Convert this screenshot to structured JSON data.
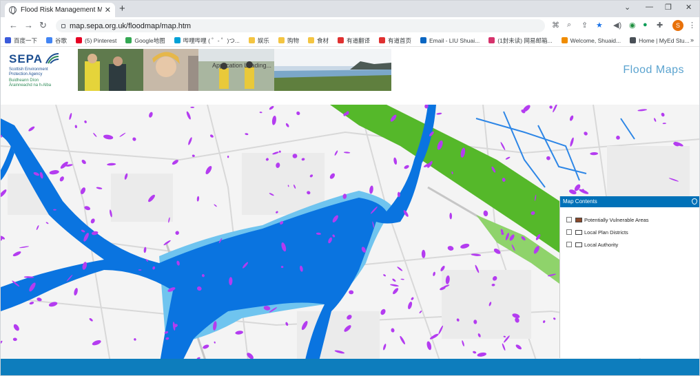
{
  "browser": {
    "tab_title": "Flood Risk Management Maps",
    "tab_close": "✕",
    "new_tab": "+",
    "url": "map.sepa.org.uk/floodmap/map.htm",
    "profile_initial": "S",
    "window_controls": [
      "⌄",
      "—",
      "❐",
      "✕"
    ]
  },
  "bookmarks": [
    {
      "label": "百度一下",
      "color": "#3b5bdb"
    },
    {
      "label": "谷歌",
      "color": "#4285f4"
    },
    {
      "label": "(5) Pinterest",
      "color": "#e60023"
    },
    {
      "label": "Google地图",
      "color": "#34a853"
    },
    {
      "label": "哔哩哔哩 ( ゜- ゜)つ...",
      "color": "#00a1d6"
    },
    {
      "label": "娱乐",
      "color": "#f4c542"
    },
    {
      "label": "购物",
      "color": "#f4c542"
    },
    {
      "label": "食材",
      "color": "#f4c542"
    },
    {
      "label": "有道翻译",
      "color": "#e03131"
    },
    {
      "label": "有道首页",
      "color": "#e03131"
    },
    {
      "label": "Email - LIU Shuai...",
      "color": "#0a66c2"
    },
    {
      "label": "(1封未读) 网易邮箱...",
      "color": "#d6336c"
    },
    {
      "label": "Welcome, Shuaid...",
      "color": "#f08c00"
    },
    {
      "label": "Home | MyEd Stu...",
      "color": "#495057"
    }
  ],
  "bookmarks_more": "»",
  "header": {
    "logo_brand": "SEPA",
    "logo_line1": "Scottish Environment",
    "logo_line2": "Protection Agency",
    "logo_gaelic1": "Buidheann Dìon",
    "logo_gaelic2": "Àrainneachd na h-Alba",
    "banner_label": "Application Loading...",
    "page_title": "Flood  Maps"
  },
  "panel": {
    "title": "Map Contents",
    "layers": [
      {
        "label": "Potentially Vulnerable Areas",
        "swatch": "#8b4a2b"
      },
      {
        "label": "Local Plan Districts",
        "swatch": "#ffffff"
      },
      {
        "label": "Local Authority",
        "swatch": "#ffffff"
      }
    ]
  },
  "colors": {
    "river_flood": "#0a74e0",
    "river_flood_light": "#6fc4ef",
    "surface_water": "#b43cf0",
    "coastal_green": "#55b82a",
    "brand_blue": "#0d7dbd"
  }
}
